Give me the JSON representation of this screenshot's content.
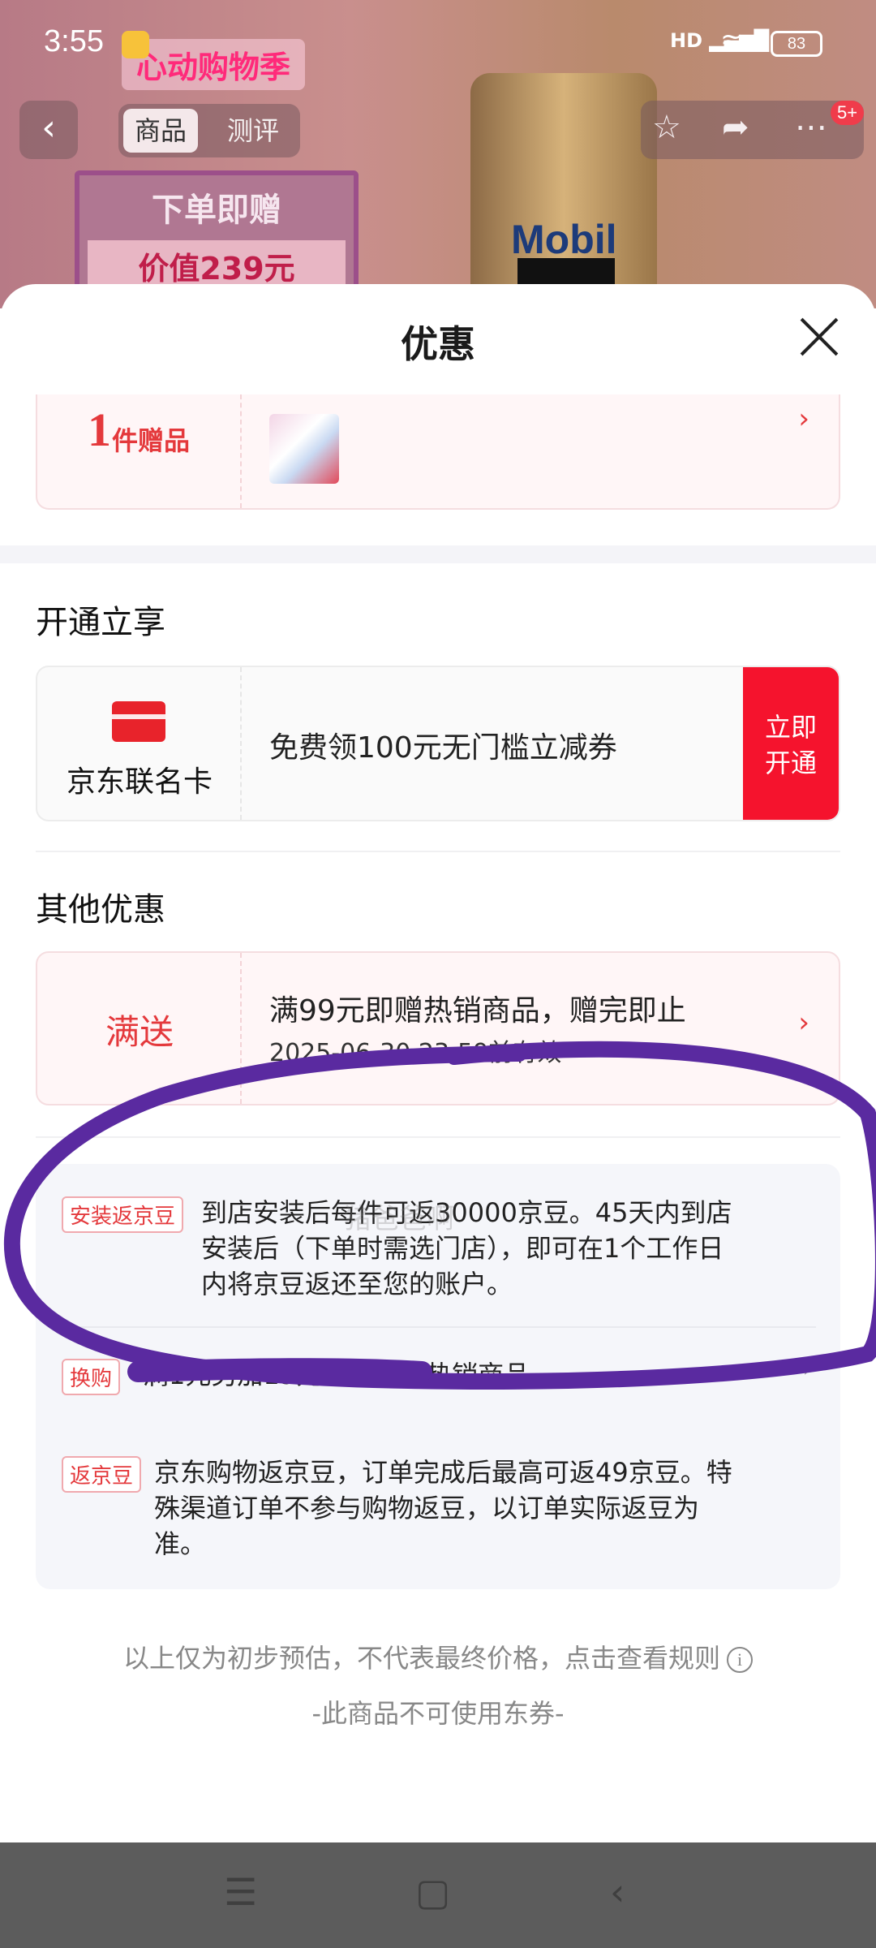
{
  "status_bar": {
    "time": "3:55",
    "network": "HD",
    "battery": "83"
  },
  "background": {
    "promo_title": "心动购物季",
    "promo_line1": "下单即赠",
    "promo_line2": "价值239元",
    "brand": "Mobil"
  },
  "top_nav": {
    "tabs": [
      "商品",
      "测评"
    ],
    "badge": "5+"
  },
  "sheet": {
    "title": "优惠",
    "gift": {
      "count": "1",
      "unit": "件赠品"
    },
    "member_section": {
      "title": "开通立享",
      "card_label": "京东联名卡",
      "offer_text": "免费领100元无门槛立减券",
      "button": "立即开通"
    },
    "other_section": {
      "title": "其他优惠",
      "full_gift": {
        "label": "满送",
        "text": "满99元即赠热销商品，赠完即止",
        "sub": "2025-06-30 23:59前有效"
      }
    },
    "promos": [
      {
        "tag": "安装返京豆",
        "text_lines": [
          "到店安装后每件可返30000京豆。45天内到店",
          "安装后（下单时需选门店），即可在1个工作日",
          "内将京豆返还至您的账户。"
        ]
      },
      {
        "tag": "换购",
        "text_lines": [
          "满1元另加19元即可换购热销商品"
        ]
      },
      {
        "tag": "返京豆",
        "text_lines": [
          "京东购物返京豆，订单完成后最高可返49京豆。特",
          "殊渠道订单不参与购物返豆，以订单实际返豆为",
          "准。"
        ]
      }
    ],
    "note": "以上仅为初步预估，不代表最终价格，点击查看规则",
    "note2": "-此商品不可使用东券-",
    "watermark": "猪爸爸啊"
  }
}
